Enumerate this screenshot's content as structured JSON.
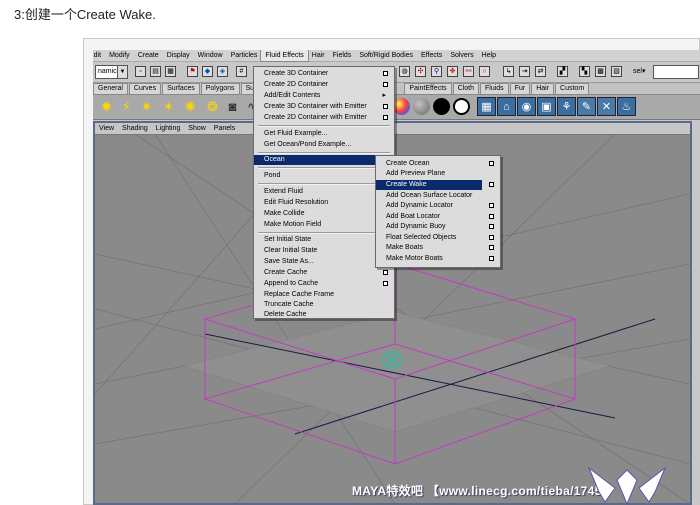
{
  "step_title": "3:创建一个Create Wake.",
  "main_menu": [
    "Edit",
    "Modify",
    "Create",
    "Display",
    "Window",
    "Particles",
    "Fluid Effects",
    "Hair",
    "Fields",
    "Soft/Rigid Bodies",
    "Effects",
    "Solvers",
    "Help"
  ],
  "mode_selector": "namics",
  "select_field_label": "sel▾",
  "shelf_tabs": [
    "General",
    "Curves",
    "Surfaces",
    "Polygons",
    "Subdivs",
    "PaintEffects",
    "Cloth",
    "Fluids",
    "Fur",
    "Hair",
    "Custom"
  ],
  "panel_menu": [
    "View",
    "Shading",
    "Lighting",
    "Show",
    "Panels"
  ],
  "fluid_menu": {
    "items": [
      {
        "label": "Create 3D Container",
        "option": true
      },
      {
        "label": "Create 2D Container",
        "option": true
      },
      {
        "label": "Add/Edit Contents",
        "submenu": true
      },
      {
        "label": "Create 3D Container with Emitter",
        "option": true
      },
      {
        "label": "Create 2D Container with Emitter",
        "option": true
      },
      {
        "label": "Get Fluid Example..."
      },
      {
        "label": "Get Ocean/Pond Example..."
      },
      {
        "label": "Ocean",
        "submenu": true,
        "highlighted": true
      },
      {
        "label": "Pond",
        "submenu": true
      },
      {
        "label": "Extend Fluid",
        "option": true
      },
      {
        "label": "Edit Fluid Resolution",
        "option": true
      },
      {
        "label": "Make Collide",
        "option": true
      },
      {
        "label": "Make Motion Field"
      },
      {
        "label": "Set Initial State",
        "option": true
      },
      {
        "label": "Clear Initial State"
      },
      {
        "label": "Save State As..."
      },
      {
        "label": "Create Cache",
        "option": true
      },
      {
        "label": "Append to Cache",
        "option": true
      },
      {
        "label": "Replace Cache Frame"
      },
      {
        "label": "Truncate Cache"
      },
      {
        "label": "Delete Cache"
      }
    ]
  },
  "ocean_menu": {
    "items": [
      {
        "label": "Create Ocean",
        "option": true
      },
      {
        "label": "Add Preview Plane"
      },
      {
        "label": "Create Wake",
        "option": true,
        "highlighted": true
      },
      {
        "label": "Add Ocean Surface Locator"
      },
      {
        "label": "Add Dynamic Locator",
        "option": true
      },
      {
        "label": "Add Boat Locator",
        "option": true
      },
      {
        "label": "Add Dynamic Buoy",
        "option": true
      },
      {
        "label": "Float Selected Objects",
        "option": true
      },
      {
        "label": "Make Boats",
        "option": true
      },
      {
        "label": "Make Motor Boats",
        "option": true
      }
    ]
  },
  "watermark": "MAYA特效吧 【www.linecg.com/tieba/1745】",
  "colors": {
    "menu_highlight": "#0a2a6c",
    "container_outline": "#c03cc0",
    "viewport_bg": "#8a8a8a",
    "grid": "#6e6e6e",
    "emitter": "#30c0a0"
  }
}
